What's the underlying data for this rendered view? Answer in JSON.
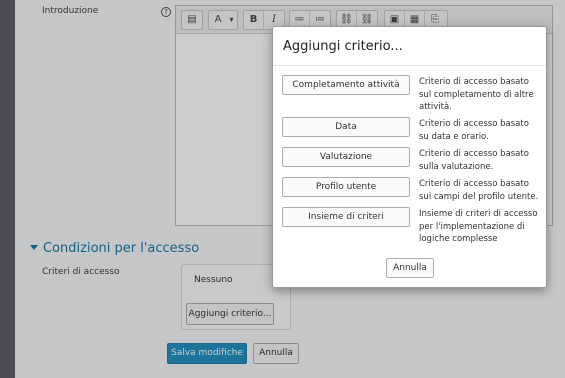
{
  "form": {
    "intro_label": "Introduzione",
    "help_glyph": "?",
    "section_title": "Condizioni per l'accesso",
    "criteria_label": "Criteri di accesso",
    "none_text": "Nessuno",
    "add_criterion_label": "Aggiungi criterio...",
    "save_label": "Salva modifiche",
    "cancel_label": "Annulla"
  },
  "toolbar": {
    "buttons": [
      "▤",
      "A",
      "▾",
      "B",
      "I",
      "≔",
      "≔",
      "⛓",
      "⛓",
      "▣",
      "▦",
      "⎘"
    ]
  },
  "modal": {
    "title": "Aggiungi criterio...",
    "criteria": [
      {
        "label": "Completamento attività",
        "description": "Criterio di accesso basato sul completamento di altre attività."
      },
      {
        "label": "Data",
        "description": "Criterio di accesso basato su data e orario."
      },
      {
        "label": "Valutazione",
        "description": "Criterio di accesso basato sulla valutazione."
      },
      {
        "label": "Profilo utente",
        "description": "Criterio di accesso basato sui campi del profilo utente."
      },
      {
        "label": "Insieme di criteri",
        "description": "Insieme di criteri di accesso per l'implementazione di logiche complesse"
      }
    ],
    "cancel_label": "Annulla"
  },
  "colors": {
    "accent": "#1177a5",
    "primary_button": "#1f8fbe",
    "sidebar": "#5e5a62"
  }
}
